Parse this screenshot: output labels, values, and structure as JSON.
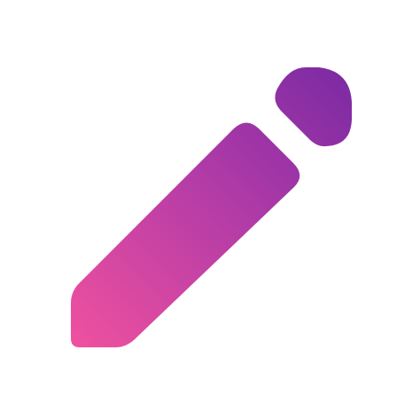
{
  "icon": {
    "name": "pencil-icon",
    "colors": {
      "gradient_start": "#f0519e",
      "gradient_mid": "#b13ba7",
      "gradient_end": "#7b2aa3"
    }
  }
}
